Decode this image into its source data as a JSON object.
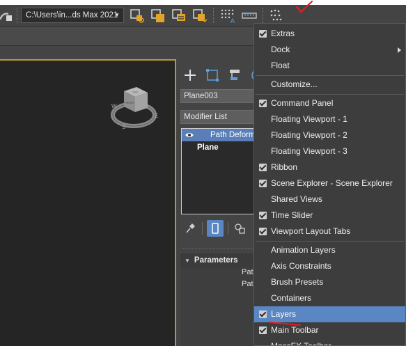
{
  "toolbar": {
    "path_text": "C:\\Users\\in...ds Max 2021"
  },
  "command_panel": {
    "object_name": "Plane003",
    "modifier_list_label": "Modifier List",
    "stack_items": [
      "Path Deform",
      "Plane"
    ],
    "parameters_label": "Parameters",
    "param_rows": [
      "Pat",
      "Pat"
    ]
  },
  "viewcube": {
    "face_top": "TOP",
    "face_front": "FRONT",
    "compass": [
      "W",
      "S",
      "E"
    ]
  },
  "menu": {
    "items": [
      {
        "label": "Extras",
        "checked": true
      },
      {
        "label": "Dock",
        "checked": false,
        "submenu": true
      },
      {
        "label": "Float",
        "checked": false
      },
      {
        "label": "Customize...",
        "checked": false
      },
      {
        "label": "Command Panel",
        "checked": true
      },
      {
        "label": "Floating Viewport - 1",
        "checked": false
      },
      {
        "label": "Floating Viewport - 2",
        "checked": false
      },
      {
        "label": "Floating Viewport - 3",
        "checked": false
      },
      {
        "label": "Ribbon",
        "checked": true
      },
      {
        "label": "Scene Explorer - Scene Explorer",
        "checked": true
      },
      {
        "label": "Shared Views",
        "checked": false
      },
      {
        "label": "Time Slider",
        "checked": true
      },
      {
        "label": "Viewport Layout Tabs",
        "checked": true
      },
      {
        "label": "Animation Layers",
        "checked": false
      },
      {
        "label": "Axis Constraints",
        "checked": false
      },
      {
        "label": "Brush Presets",
        "checked": false
      },
      {
        "label": "Containers",
        "checked": false
      },
      {
        "label": "Layers",
        "checked": true,
        "highlighted": true
      },
      {
        "label": "Main Toolbar",
        "checked": true
      },
      {
        "label": "MassFX Toolbar",
        "checked": false
      }
    ]
  },
  "colors": {
    "menu_highlight": "#5a86c3",
    "viewport_border": "#b9963a",
    "annotation_red": "#e02020"
  }
}
